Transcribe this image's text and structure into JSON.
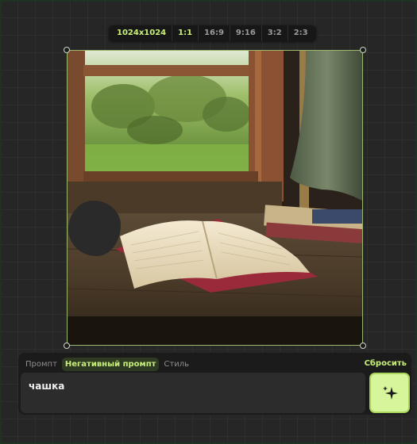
{
  "aspect_ratios": {
    "active": "1024x1024",
    "items": [
      "1024x1024",
      "1:1",
      "16:9",
      "9:16",
      "3:2",
      "2:3"
    ]
  },
  "canvas": {
    "image_subject": "open book on a wooden windowsill"
  },
  "prompt_panel": {
    "tabs": [
      {
        "label": "Промпт",
        "active": false
      },
      {
        "label": "Негативный промпт",
        "active": true
      },
      {
        "label": "Стиль",
        "active": false
      }
    ],
    "reset_label": "Сбросить",
    "prompt_value": "чашка",
    "generate_icon": "sparkle-icon"
  },
  "colors": {
    "accent": "#c8f07a",
    "button_bg": "#d7f59a",
    "panel_bg": "#1b1b1b"
  }
}
